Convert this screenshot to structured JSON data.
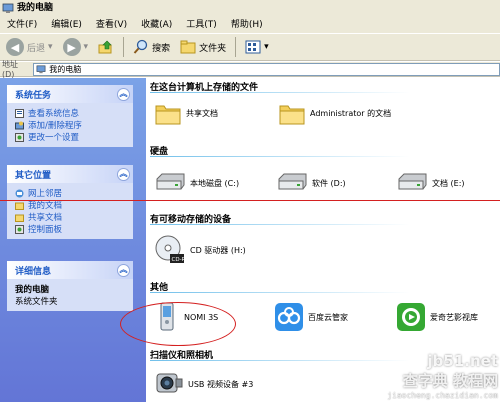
{
  "window": {
    "title": "我的电脑"
  },
  "menu": [
    "文件(F)",
    "编辑(E)",
    "查看(V)",
    "收藏(A)",
    "工具(T)",
    "帮助(H)"
  ],
  "toolbar": {
    "back_label": "后退",
    "search_label": "搜索",
    "folders_label": "文件夹"
  },
  "address": {
    "label": "地址(D)",
    "value": "我的电脑"
  },
  "sidebar": {
    "system_tasks": {
      "title": "系统任务",
      "items": [
        "查看系统信息",
        "添加/删除程序",
        "更改一个设置"
      ]
    },
    "other_places": {
      "title": "其它位置",
      "items": [
        "网上邻居",
        "我的文档",
        "共享文档",
        "控制面板"
      ]
    },
    "details": {
      "title": "详细信息",
      "name": "我的电脑",
      "type": "系统文件夹"
    }
  },
  "groups": {
    "stored_files": {
      "title": "在这台计算机上存储的文件",
      "items": [
        "共享文档",
        "Administrator 的文档"
      ]
    },
    "hard_disks": {
      "title": "硬盘",
      "items": [
        "本地磁盘 (C:)",
        "软件 (D:)",
        "文档 (E:)"
      ]
    },
    "removable": {
      "title": "有可移动存储的设备",
      "items": [
        "CD 驱动器 (H:)"
      ]
    },
    "other": {
      "title": "其他",
      "items": [
        "NOMI 3S",
        "百度云管家",
        "爱奇艺影视库"
      ]
    },
    "scanners": {
      "title": "扫描仪和照相机",
      "items": [
        "USB 视频设备 #3"
      ]
    }
  },
  "watermark": {
    "site": "jb51.net",
    "cn": "查字典 教程网",
    "url": "jiaocheng.chazidian.com"
  },
  "colors": {
    "sidebar_top": "#7ba2e7",
    "sidebar_bottom": "#6375d6",
    "link": "#215dc6",
    "annotation": "#d42020"
  }
}
